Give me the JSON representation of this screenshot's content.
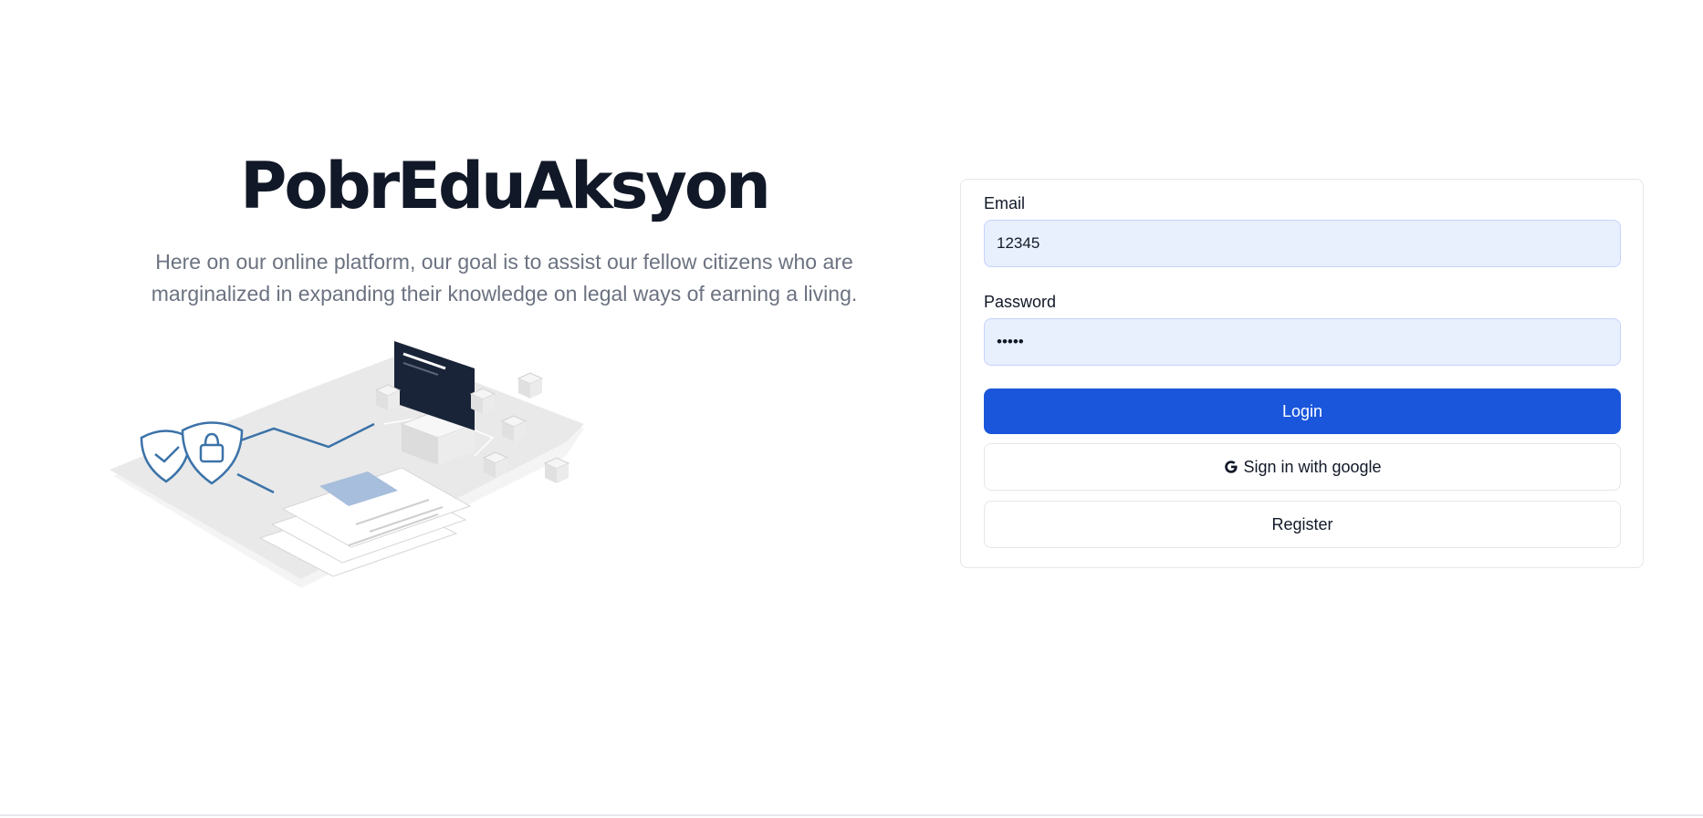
{
  "hero": {
    "title": "PobrEduAksyon",
    "description": "Here on our online platform, our goal is to assist our fellow citizens who are marginalized in expanding their knowledge on legal ways of earning a living."
  },
  "login_form": {
    "email_label": "Email",
    "email_value": "12345",
    "password_label": "Password",
    "password_value": "•••••",
    "login_label": "Login",
    "google_label": "Sign in with google",
    "google_icon": "google-icon",
    "register_label": "Register"
  },
  "colors": {
    "primary": "#1a56db",
    "input_bg": "#e8f0fe",
    "title": "#111827",
    "description": "#6b7280"
  }
}
